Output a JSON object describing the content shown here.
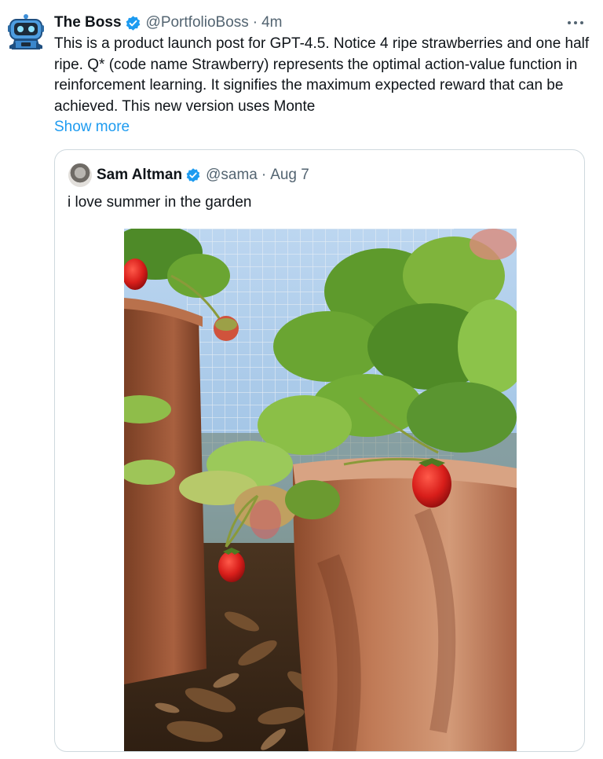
{
  "tweet": {
    "author": {
      "name": "The Boss",
      "handle": "@PortfolioBoss",
      "separator": "·",
      "time": "4m",
      "avatar_icon": "robot-avatar-icon"
    },
    "text": "This is a product launch post for GPT-4.5. Notice 4 ripe strawberries and one half ripe. Q* (code name Strawberry) represents the optimal action-value function in reinforcement learning. It signifies the maximum expected reward that can be achieved. This new version uses Monte",
    "show_more_label": "Show more",
    "more_icon": "more-options-icon"
  },
  "quoted_tweet": {
    "author": {
      "name": "Sam Altman",
      "handle": "@sama",
      "separator": "·",
      "time": "Aug 7"
    },
    "text": "i love summer in the garden",
    "image": "strawberry-plants-in-terracotta-pots"
  },
  "colors": {
    "link": "#1d9bf0",
    "verified": "#1d9bf0",
    "secondary_text": "#536471",
    "border": "#cfd9de"
  }
}
